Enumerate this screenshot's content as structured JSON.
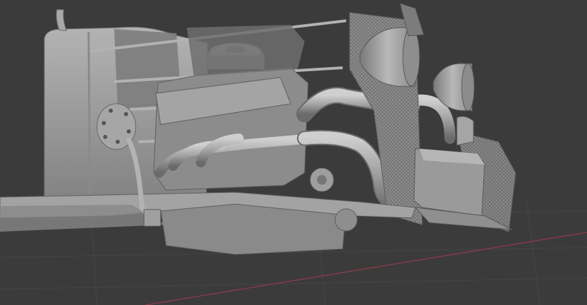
{
  "viewport": {
    "background_color": "#3b3b3b",
    "grid_color": "#474747",
    "x_axis_color": "#9a3b4a",
    "model_color": "#9a9a9a",
    "model_shadow_color": "#6d6d6d",
    "model_highlight_color": "#c4c4c4",
    "shading_mode": "solid",
    "subject": "car-chassis-with-v8-engine-model"
  }
}
